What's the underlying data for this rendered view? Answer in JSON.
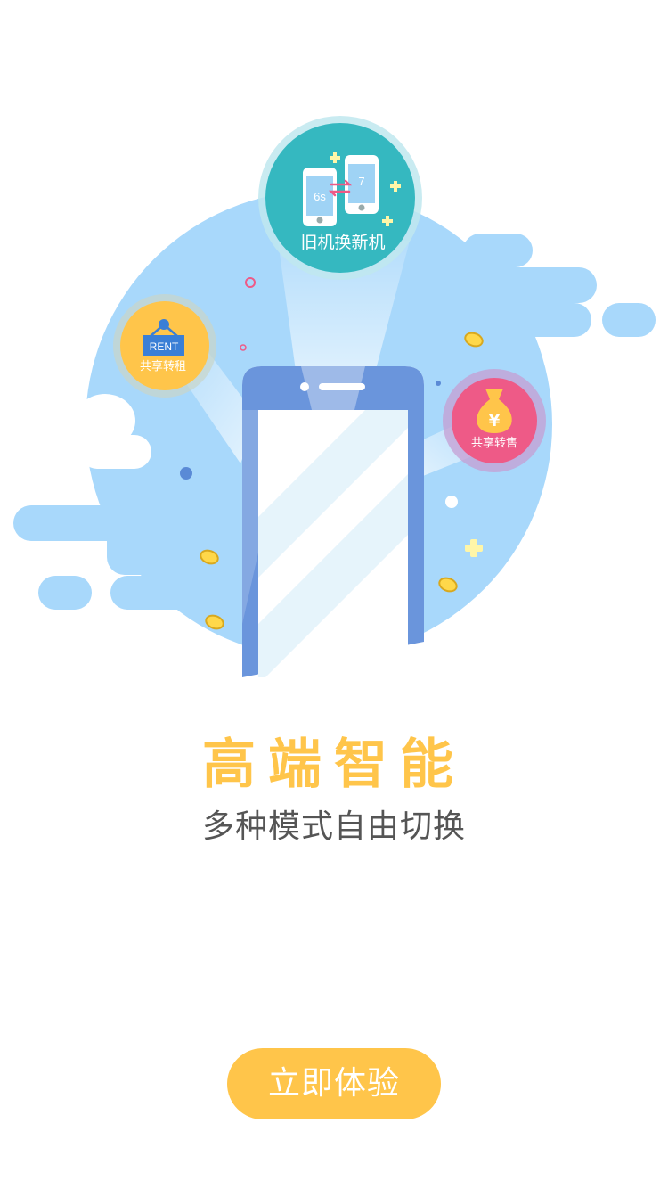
{
  "illustration": {
    "badge_trade_in": {
      "label": "旧机换新机",
      "old_phone_model": "6s",
      "new_phone_model": "7",
      "icon": "phone-exchange-icon"
    },
    "badge_rent": {
      "sign_text": "RENT",
      "label": "共享转租",
      "icon": "rent-sign-icon"
    },
    "badge_sell": {
      "label": "共享转售",
      "currency_symbol": "¥",
      "icon": "money-bag-icon"
    }
  },
  "headline": "高端智能",
  "subheadline": "多种模式自由切换",
  "cta_label": "立即体验",
  "colors": {
    "accent": "#ffc54a",
    "sky": "#a8d8fb",
    "phone_frame": "#6a95dc",
    "teal_badge": "#35b8c0",
    "pink_badge": "#ee5a87",
    "subtitle": "#555555"
  }
}
